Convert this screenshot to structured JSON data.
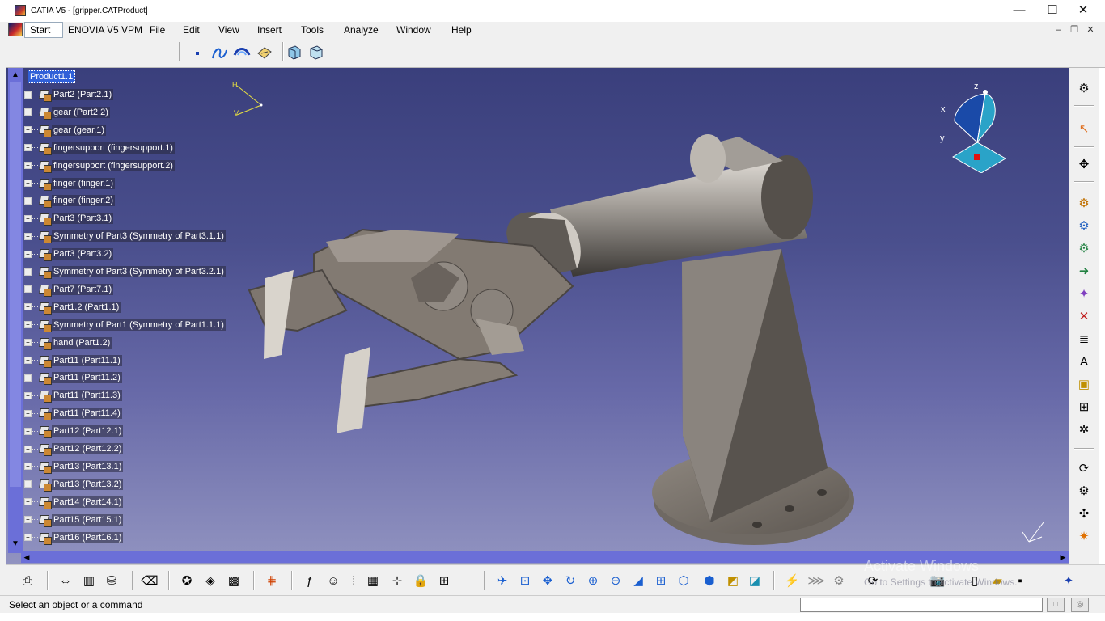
{
  "window": {
    "title": "CATIA V5 - [gripper.CATProduct]",
    "minimize_glyph": "—",
    "maximize_glyph": "☐",
    "close_glyph": "✕"
  },
  "menubar": {
    "start": "Start",
    "items": [
      "ENOVIA V5 VPM",
      "File",
      "Edit",
      "View",
      "Insert",
      "Tools",
      "Analyze",
      "Window",
      "Help"
    ],
    "mdi_min": "–",
    "mdi_restore": "❐",
    "mdi_close": "✕"
  },
  "toolbar_top": {
    "icons": [
      "point-icon",
      "spline-icon",
      "sweep-icon",
      "surface-icon",
      "fit-icon",
      "normal-view-icon"
    ]
  },
  "tree": {
    "root": "Product1.1",
    "items": [
      "Part2 (Part2.1)",
      "gear (Part2.2)",
      "gear (gear.1)",
      "fingersupport (fingersupport.1)",
      "fingersupport (fingersupport.2)",
      "finger (finger.1)",
      "finger (finger.2)",
      "Part3 (Part3.1)",
      "Symmetry of Part3 (Symmetry of Part3.1.1)",
      "Part3 (Part3.2)",
      "Symmetry of Part3 (Symmetry of Part3.2.1)",
      "Part7 (Part7.1)",
      "Part1.2 (Part1.1)",
      "Symmetry of Part1 (Symmetry of Part1.1.1)",
      "hand (Part1.2)",
      "Part11 (Part11.1)",
      "Part11 (Part11.2)",
      "Part11 (Part11.3)",
      "Part11 (Part11.4)",
      "Part12 (Part12.1)",
      "Part12 (Part12.2)",
      "Part13 (Part13.1)",
      "Part13 (Part13.2)",
      "Part14 (Part14.1)",
      "Part15 (Part15.1)",
      "Part16 (Part16.1)"
    ]
  },
  "compass": {
    "x": "x",
    "y": "y",
    "z": "z"
  },
  "axis_small": {
    "h": "H",
    "v": "V"
  },
  "status": {
    "message": "Select an object or a command",
    "btn1": "□",
    "btn2": "◎"
  },
  "watermark": {
    "line1": "Activate Windows",
    "line2": "Go to Settings to activate Windows."
  },
  "colors": {
    "viewport_top": "#3a3f7c",
    "viewport_bottom": "#9193c0",
    "selection": "#3060d8"
  }
}
